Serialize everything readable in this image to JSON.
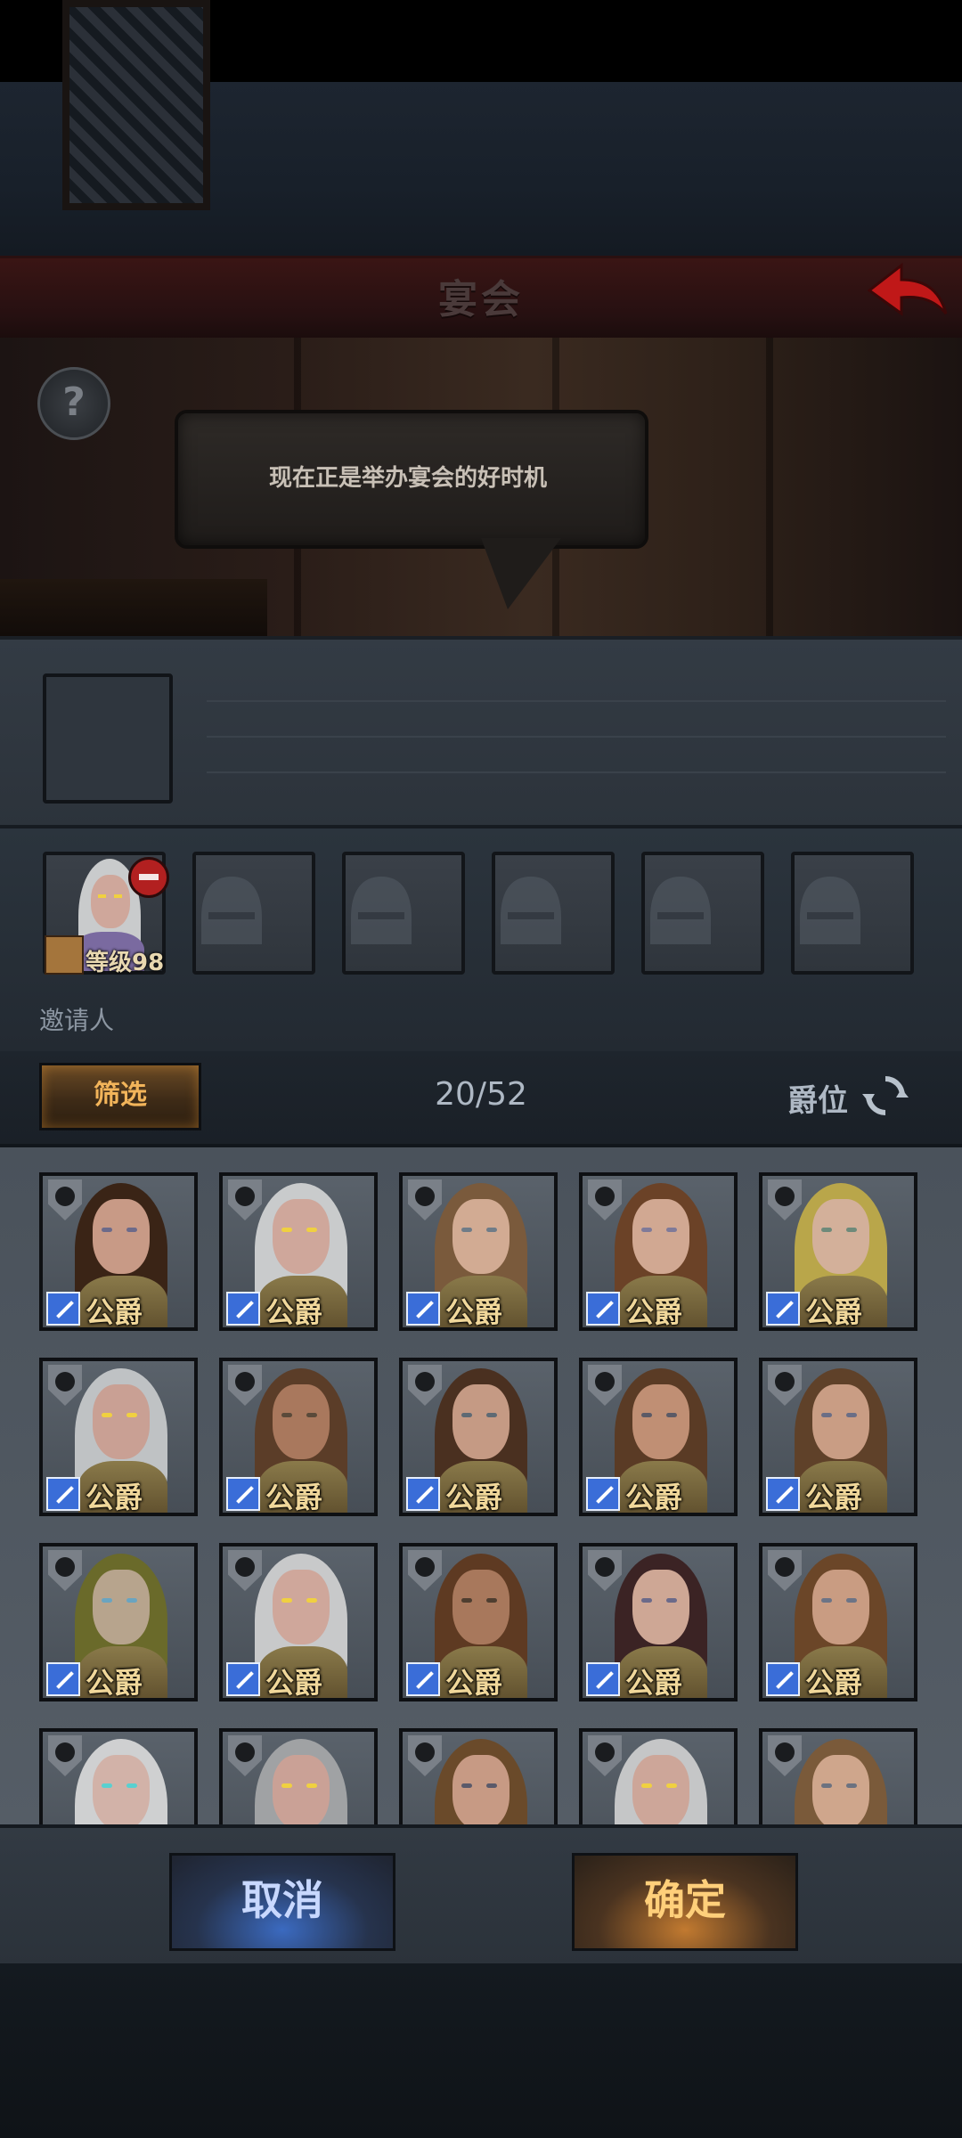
{
  "header": {
    "title": "宴会",
    "back_icon": "back-arrow-icon"
  },
  "scene": {
    "speech": "现在正是举办宴会的好时机",
    "help_icon": "help-icon",
    "help_symbol": "?"
  },
  "invitees": {
    "label": "邀请人",
    "host": {
      "level_text": "等级98",
      "remove_icon": "remove-icon",
      "class_icon": "staff-icon"
    },
    "empty_slot_icon": "knight-helmet-icon",
    "empty_slots": 5
  },
  "filter": {
    "button_label": "筛选",
    "count": "20/52",
    "sort_label": "爵位",
    "sort_icon": "refresh-icon"
  },
  "grid": {
    "rank_label": "公爵",
    "crest_icon": "sun-crest-icon",
    "class_icon": "sword-icon",
    "cards": [
      {
        "hair": "#3a2416",
        "skin": "#c89a86",
        "eye": "#6c6a8a"
      },
      {
        "hair": "#c9cbcc",
        "skin": "#cfa79b",
        "eye": "#f0d040"
      },
      {
        "hair": "#7a5a3c",
        "skin": "#d2ab93",
        "eye": "#6f7c88"
      },
      {
        "hair": "#6b4227",
        "skin": "#d1a892",
        "eye": "#7f7a99"
      },
      {
        "hair": "#b9a64a",
        "skin": "#d3b09a",
        "eye": "#6e8a7a"
      },
      {
        "hair": "#bfc2c4",
        "skin": "#c9a094",
        "eye": "#f0d040"
      },
      {
        "hair": "#5b3d28",
        "skin": "#a9785d",
        "eye": "#5a4a3a"
      },
      {
        "hair": "#4a3020",
        "skin": "#c59a84",
        "eye": "#5e6a74"
      },
      {
        "hair": "#5a3b25",
        "skin": "#c08f74",
        "eye": "#5b5a66"
      },
      {
        "hair": "#5f4129",
        "skin": "#c99d84",
        "eye": "#6a6e86"
      },
      {
        "hair": "#6a6a2a",
        "skin": "#b7a48d",
        "eye": "#6aa4c0"
      },
      {
        "hair": "#c8c9ca",
        "skin": "#cfa79b",
        "eye": "#f0d040"
      },
      {
        "hair": "#5e3a22",
        "skin": "#a8785c",
        "eye": "#4e3e30"
      },
      {
        "hair": "#3b2324",
        "skin": "#cea795",
        "eye": "#6b6a8a"
      },
      {
        "hair": "#6b4628",
        "skin": "#c99c82",
        "eye": "#6c7486"
      },
      {
        "hair": "#cfd0d1",
        "skin": "#d2b2a8",
        "eye": "#5ad0d0"
      },
      {
        "hair": "#a0a2a4",
        "skin": "#caa196",
        "eye": "#f0d040"
      },
      {
        "hair": "#6a4a2a",
        "skin": "#c79a84",
        "eye": "#5a5a6a"
      },
      {
        "hair": "#c5c6c7",
        "skin": "#cda699",
        "eye": "#f0d040"
      },
      {
        "hair": "#7a5a3a",
        "skin": "#cfa68c",
        "eye": "#6c7280"
      }
    ]
  },
  "actions": {
    "cancel_label": "取消",
    "confirm_label": "确定"
  },
  "colors": {
    "title_bar": "#2a1011",
    "back_arrow": "#c01818",
    "filter_glow": "#f2b45a",
    "cancel_glow": "#3b6ac0",
    "confirm_glow": "#c27a30"
  }
}
